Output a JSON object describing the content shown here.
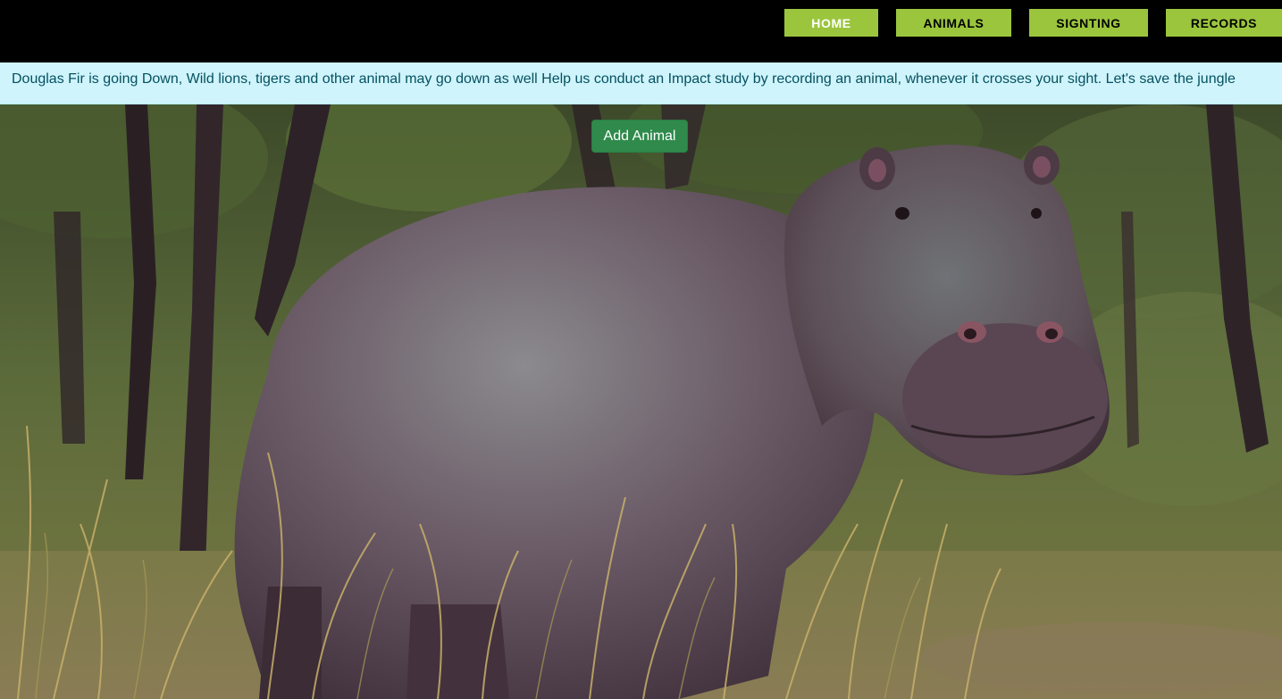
{
  "nav": {
    "items": [
      {
        "label": "HOME"
      },
      {
        "label": "ANIMALS"
      },
      {
        "label": "SIGNTING"
      },
      {
        "label": "RECORDS"
      }
    ]
  },
  "banner": {
    "text": "Douglas Fir is going Down, Wild lions, tigers and other animal may go down as well Help us conduct an Impact study by recording an animal, whenever it crosses your sight. Let's save the jungle"
  },
  "actions": {
    "add_animal_label": "Add Animal"
  },
  "colors": {
    "nav_background": "#000000",
    "nav_button": "#9bc53d",
    "banner_background": "#cff4fc",
    "banner_text": "#055160",
    "add_button": "#2f8a4b"
  }
}
